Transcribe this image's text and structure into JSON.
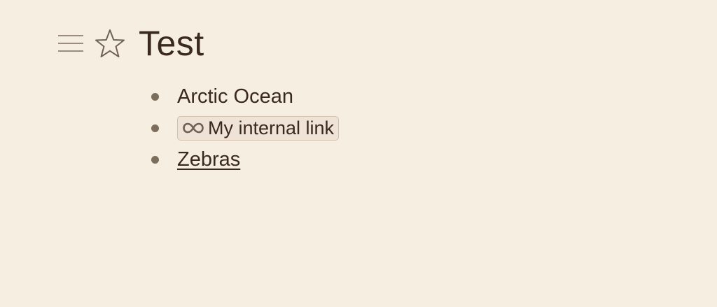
{
  "header": {
    "title": "Test",
    "menu_icon": "hamburger-menu-icon",
    "star_icon": "star-outline-icon"
  },
  "colors": {
    "background": "#f6efe1",
    "text": "#3a2a1d",
    "bullet": "#7c6d5d",
    "link_chip_background": "#eee3d6",
    "link_chip_border": "#d6bfae"
  },
  "bullets": [
    {
      "type": "text",
      "text": "Arctic Ocean"
    },
    {
      "type": "internal-link",
      "icon": "infinity-link-icon",
      "text": "My internal link"
    },
    {
      "type": "link",
      "text": "Zebras"
    }
  ]
}
